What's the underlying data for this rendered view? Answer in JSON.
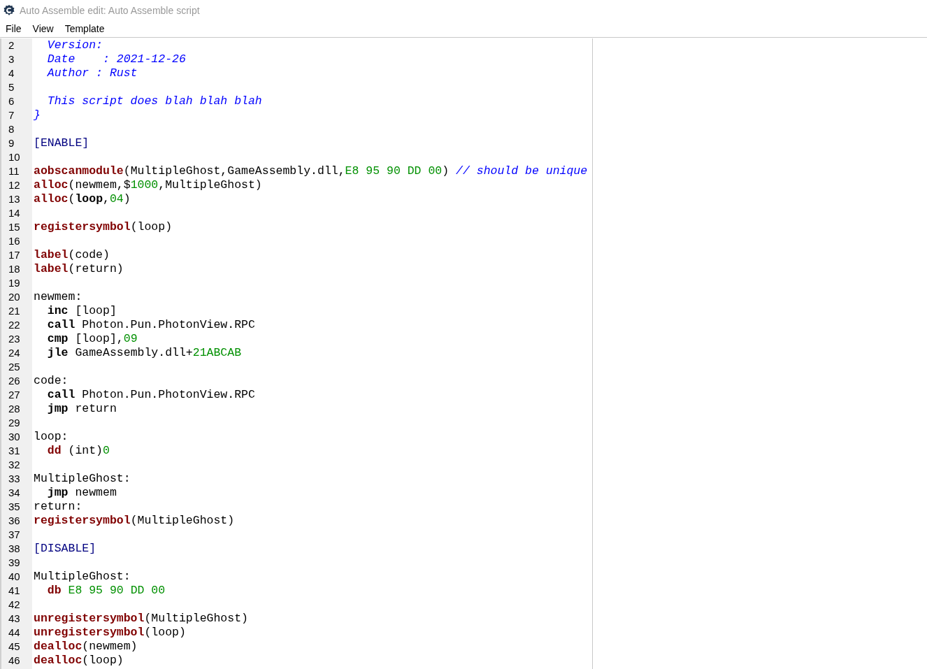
{
  "window": {
    "title": "Auto Assemble edit: Auto Assemble script"
  },
  "menu": [
    "File",
    "View",
    "Template"
  ],
  "editor": {
    "lines": [
      {
        "number": "2",
        "tokens": [
          {
            "kind": "comment",
            "text": "  Version:"
          }
        ]
      },
      {
        "number": "3",
        "tokens": [
          {
            "kind": "comment",
            "text": "  Date    : 2021-12-26"
          }
        ]
      },
      {
        "number": "4",
        "tokens": [
          {
            "kind": "comment",
            "text": "  Author : Rust"
          }
        ]
      },
      {
        "number": "5"
      },
      {
        "number": "6",
        "tokens": [
          {
            "kind": "comment",
            "text": "  This script does blah blah blah"
          }
        ]
      },
      {
        "number": "7",
        "tokens": [
          {
            "kind": "comment",
            "text": "}"
          }
        ]
      },
      {
        "number": "8"
      },
      {
        "number": "9",
        "tokens": [
          {
            "kind": "section",
            "text": "[ENABLE]"
          }
        ]
      },
      {
        "number": "10"
      },
      {
        "number": "11",
        "tokens": [
          {
            "kind": "keyword",
            "text": "aobscanmodule"
          },
          {
            "kind": "plain",
            "text": "(MultipleGhost,GameAssembly.dll,"
          },
          {
            "kind": "number",
            "text": "E8 95 90 DD 00"
          },
          {
            "kind": "plain",
            "text": ") "
          },
          {
            "kind": "comment",
            "text": "// should be unique"
          }
        ]
      },
      {
        "number": "12",
        "tokens": [
          {
            "kind": "keyword",
            "text": "alloc"
          },
          {
            "kind": "plain",
            "text": "(newmem,$"
          },
          {
            "kind": "number",
            "text": "1000"
          },
          {
            "kind": "plain",
            "text": ",MultipleGhost)"
          }
        ]
      },
      {
        "number": "13",
        "tokens": [
          {
            "kind": "keyword",
            "text": "alloc"
          },
          {
            "kind": "plain",
            "text": "("
          },
          {
            "kind": "instruction",
            "text": "loop"
          },
          {
            "kind": "plain",
            "text": ","
          },
          {
            "kind": "number",
            "text": "04"
          },
          {
            "kind": "plain",
            "text": ")"
          }
        ]
      },
      {
        "number": "14"
      },
      {
        "number": "15",
        "tokens": [
          {
            "kind": "keyword",
            "text": "registersymbol"
          },
          {
            "kind": "plain",
            "text": "(loop)"
          }
        ]
      },
      {
        "number": "16"
      },
      {
        "number": "17",
        "tokens": [
          {
            "kind": "keyword",
            "text": "label"
          },
          {
            "kind": "plain",
            "text": "(code)"
          }
        ]
      },
      {
        "number": "18",
        "tokens": [
          {
            "kind": "keyword",
            "text": "label"
          },
          {
            "kind": "plain",
            "text": "(return)"
          }
        ]
      },
      {
        "number": "19"
      },
      {
        "number": "20",
        "tokens": [
          {
            "kind": "plain",
            "text": "newmem:"
          }
        ]
      },
      {
        "number": "21",
        "indented": true,
        "tokens": [
          {
            "kind": "instruction",
            "text": "inc"
          },
          {
            "kind": "plain",
            "text": " [loop]"
          }
        ]
      },
      {
        "number": "22",
        "indented": true,
        "tokens": [
          {
            "kind": "instruction",
            "text": "call"
          },
          {
            "kind": "plain",
            "text": " Photon.Pun.PhotonView.RPC"
          }
        ]
      },
      {
        "number": "23",
        "indented": true,
        "tokens": [
          {
            "kind": "instruction",
            "text": "cmp"
          },
          {
            "kind": "plain",
            "text": " [loop],"
          },
          {
            "kind": "number",
            "text": "09"
          }
        ]
      },
      {
        "number": "24",
        "indented": true,
        "tokens": [
          {
            "kind": "instruction",
            "text": "jle"
          },
          {
            "kind": "plain",
            "text": " GameAssembly.dll+"
          },
          {
            "kind": "number",
            "text": "21ABCAB"
          }
        ]
      },
      {
        "number": "25"
      },
      {
        "number": "26",
        "tokens": [
          {
            "kind": "plain",
            "text": "code:"
          }
        ]
      },
      {
        "number": "27",
        "indented": true,
        "tokens": [
          {
            "kind": "instruction",
            "text": "call"
          },
          {
            "kind": "plain",
            "text": " Photon.Pun.PhotonView.RPC"
          }
        ]
      },
      {
        "number": "28",
        "indented": true,
        "tokens": [
          {
            "kind": "instruction",
            "text": "jmp"
          },
          {
            "kind": "plain",
            "text": " return"
          }
        ]
      },
      {
        "number": "29"
      },
      {
        "number": "30",
        "tokens": [
          {
            "kind": "plain",
            "text": "loop:"
          }
        ]
      },
      {
        "number": "31",
        "indented": true,
        "tokens": [
          {
            "kind": "keyword",
            "text": "dd"
          },
          {
            "kind": "plain",
            "text": " (int)"
          },
          {
            "kind": "number",
            "text": "0"
          }
        ]
      },
      {
        "number": "32"
      },
      {
        "number": "33",
        "tokens": [
          {
            "kind": "plain",
            "text": "MultipleGhost:"
          }
        ]
      },
      {
        "number": "34",
        "indented": true,
        "tokens": [
          {
            "kind": "instruction",
            "text": "jmp"
          },
          {
            "kind": "plain",
            "text": " newmem"
          }
        ]
      },
      {
        "number": "35",
        "tokens": [
          {
            "kind": "plain",
            "text": "return:"
          }
        ]
      },
      {
        "number": "36",
        "tokens": [
          {
            "kind": "keyword",
            "text": "registersymbol"
          },
          {
            "kind": "plain",
            "text": "(MultipleGhost)"
          }
        ]
      },
      {
        "number": "37"
      },
      {
        "number": "38",
        "tokens": [
          {
            "kind": "section",
            "text": "[DISABLE]"
          }
        ]
      },
      {
        "number": "39"
      },
      {
        "number": "40",
        "tokens": [
          {
            "kind": "plain",
            "text": "MultipleGhost:"
          }
        ]
      },
      {
        "number": "41",
        "indented": true,
        "tokens": [
          {
            "kind": "keyword",
            "text": "db "
          },
          {
            "kind": "number",
            "text": "E8 95 90 DD 00"
          }
        ]
      },
      {
        "number": "42"
      },
      {
        "number": "43",
        "tokens": [
          {
            "kind": "keyword",
            "text": "unregistersymbol"
          },
          {
            "kind": "plain",
            "text": "(MultipleGhost)"
          }
        ]
      },
      {
        "number": "44",
        "tokens": [
          {
            "kind": "keyword",
            "text": "unregistersymbol"
          },
          {
            "kind": "plain",
            "text": "(loop)"
          }
        ]
      },
      {
        "number": "45",
        "tokens": [
          {
            "kind": "keyword",
            "text": "dealloc"
          },
          {
            "kind": "plain",
            "text": "(newmem)"
          }
        ]
      },
      {
        "number": "46",
        "tokens": [
          {
            "kind": "keyword",
            "text": "dealloc"
          },
          {
            "kind": "plain",
            "text": "(loop)"
          }
        ]
      }
    ]
  }
}
